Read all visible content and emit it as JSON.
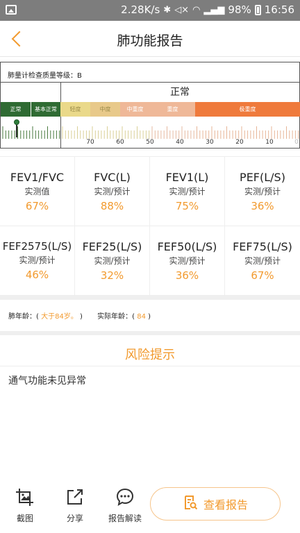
{
  "status_bar": {
    "speed": "2.28K/s",
    "battery": "98%",
    "time": "16:56"
  },
  "header": {
    "title": "肺功能报告"
  },
  "gauge": {
    "quality_label": "肺量计检查质量等级：B",
    "normal_title": "正常",
    "levels": [
      {
        "label": "正常",
        "color": "#2f6b33"
      },
      {
        "label": "基本正常",
        "color": "#2f6b33"
      },
      {
        "label": "轻度",
        "color": "#ead98a"
      },
      {
        "label": "中度",
        "color": "#e8c98a"
      },
      {
        "label": "中重度",
        "color": "#efb898"
      },
      {
        "label": "重度",
        "color": "#efb898"
      },
      {
        "label": "极重度",
        "color": "#ef7a3c"
      }
    ],
    "scale_numbers": [
      "70",
      "60",
      "50",
      "40",
      "30",
      "20",
      "10",
      "0"
    ]
  },
  "metrics": [
    {
      "name": "FEV1/FVC",
      "sub": "实测值",
      "value": "67%"
    },
    {
      "name": "FVC(L)",
      "sub": "实测/预计",
      "value": "88%"
    },
    {
      "name": "FEV1(L)",
      "sub": "实测/预计",
      "value": "75%"
    },
    {
      "name": "PEF(L/S)",
      "sub": "实测/预计",
      "value": "36%"
    },
    {
      "name": "FEF2575(L/S)",
      "sub": "实测/预计",
      "value": "46%"
    },
    {
      "name": "FEF25(L/S)",
      "sub": "实测/预计",
      "value": "32%"
    },
    {
      "name": "FEF50(L/S)",
      "sub": "实测/预计",
      "value": "36%"
    },
    {
      "name": "FEF75(L/S)",
      "sub": "实测/预计",
      "value": "67%"
    }
  ],
  "age": {
    "lung_age_label": "肺年龄：(",
    "lung_age_value": "大于84岁。",
    "lung_age_close": ")",
    "actual_age_label": "实际年龄：(",
    "actual_age_value": "84",
    "actual_age_close": ")"
  },
  "risk": {
    "title": "风险提示",
    "text": "通气功能未见异常"
  },
  "bottom": {
    "screenshot_label": "截图",
    "share_label": "分享",
    "interpret_label": "报告解读",
    "view_report_label": "查看报告"
  },
  "colors": {
    "accent": "#f29a2e"
  }
}
